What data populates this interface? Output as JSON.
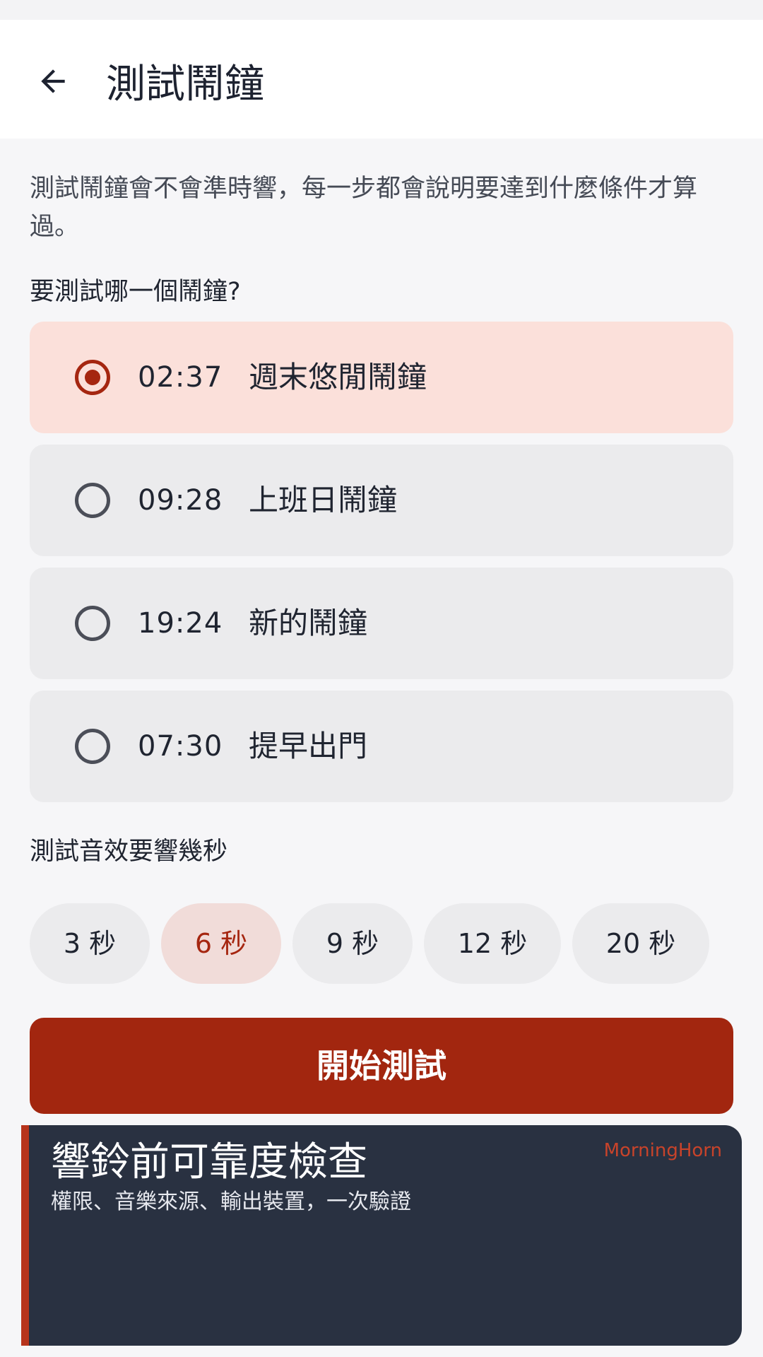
{
  "app_bar": {
    "title": "測試鬧鐘",
    "back_icon": "arrow-left-icon"
  },
  "intro_text": "測試鬧鐘會不會準時響，每一步都會說明要達到什麼條件才算過。",
  "alarm_question": "要測試哪一個鬧鐘?",
  "alarms": [
    {
      "time": "02:37",
      "name": "週末悠閒鬧鐘",
      "selected": true
    },
    {
      "time": "09:28",
      "name": "上班日鬧鐘",
      "selected": false
    },
    {
      "time": "19:24",
      "name": "新的鬧鐘",
      "selected": false
    },
    {
      "time": "07:30",
      "name": "提早出門",
      "selected": false
    }
  ],
  "duration_question": "測試音效要響幾秒",
  "durations": [
    {
      "label": "3 秒",
      "selected": false
    },
    {
      "label": "6 秒",
      "selected": true
    },
    {
      "label": "9 秒",
      "selected": false
    },
    {
      "label": "12 秒",
      "selected": false
    },
    {
      "label": "20 秒",
      "selected": false
    }
  ],
  "start_button": "開始測試",
  "promo": {
    "title": "響鈴前可靠度檢查",
    "subtitle": "權限、音樂來源、輸出裝置，一次驗證",
    "brand": "MorningHorn"
  },
  "colors": {
    "accent": "#a2260f",
    "selected_bg": "#fbe0da",
    "chip_selected_bg": "#f1dcd9",
    "promo_bg": "#293141"
  }
}
